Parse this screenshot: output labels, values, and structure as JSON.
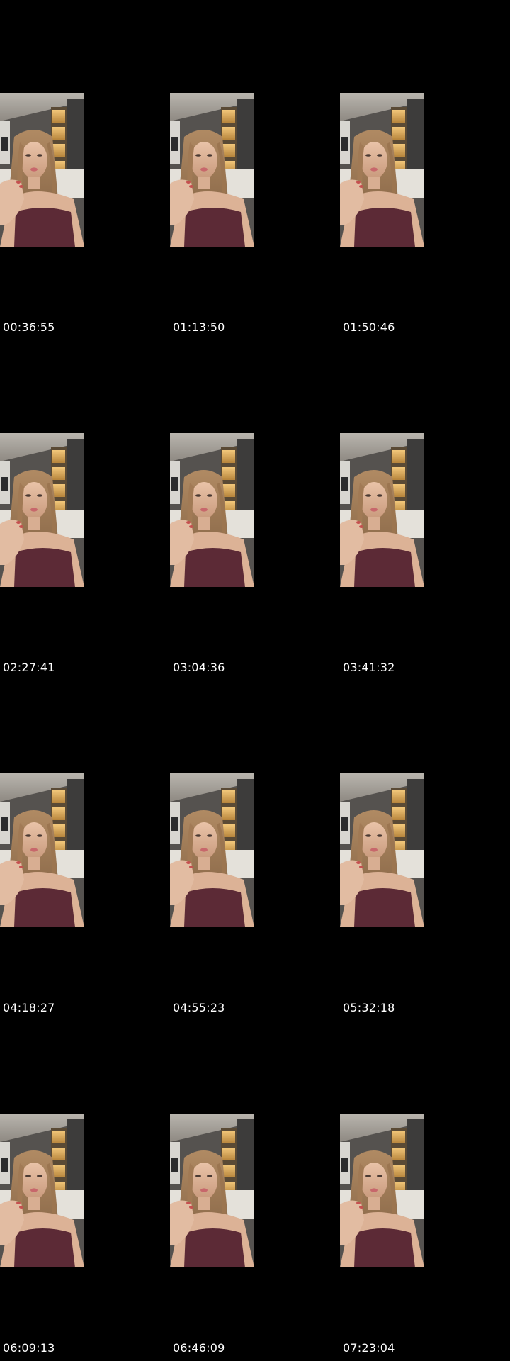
{
  "contact_sheet": {
    "background_color": "#000000",
    "timestamp_color": "#ffffff",
    "thumbnail_icon": "video-frame-thumbnail",
    "frames": [
      {
        "timestamp": "00:36:55"
      },
      {
        "timestamp": "01:13:50"
      },
      {
        "timestamp": "01:50:46"
      },
      {
        "timestamp": "02:27:41"
      },
      {
        "timestamp": "03:04:36"
      },
      {
        "timestamp": "03:41:32"
      },
      {
        "timestamp": "04:18:27"
      },
      {
        "timestamp": "04:55:23"
      },
      {
        "timestamp": "05:32:18"
      },
      {
        "timestamp": "06:09:13"
      },
      {
        "timestamp": "06:46:09"
      },
      {
        "timestamp": "07:23:04"
      }
    ]
  }
}
